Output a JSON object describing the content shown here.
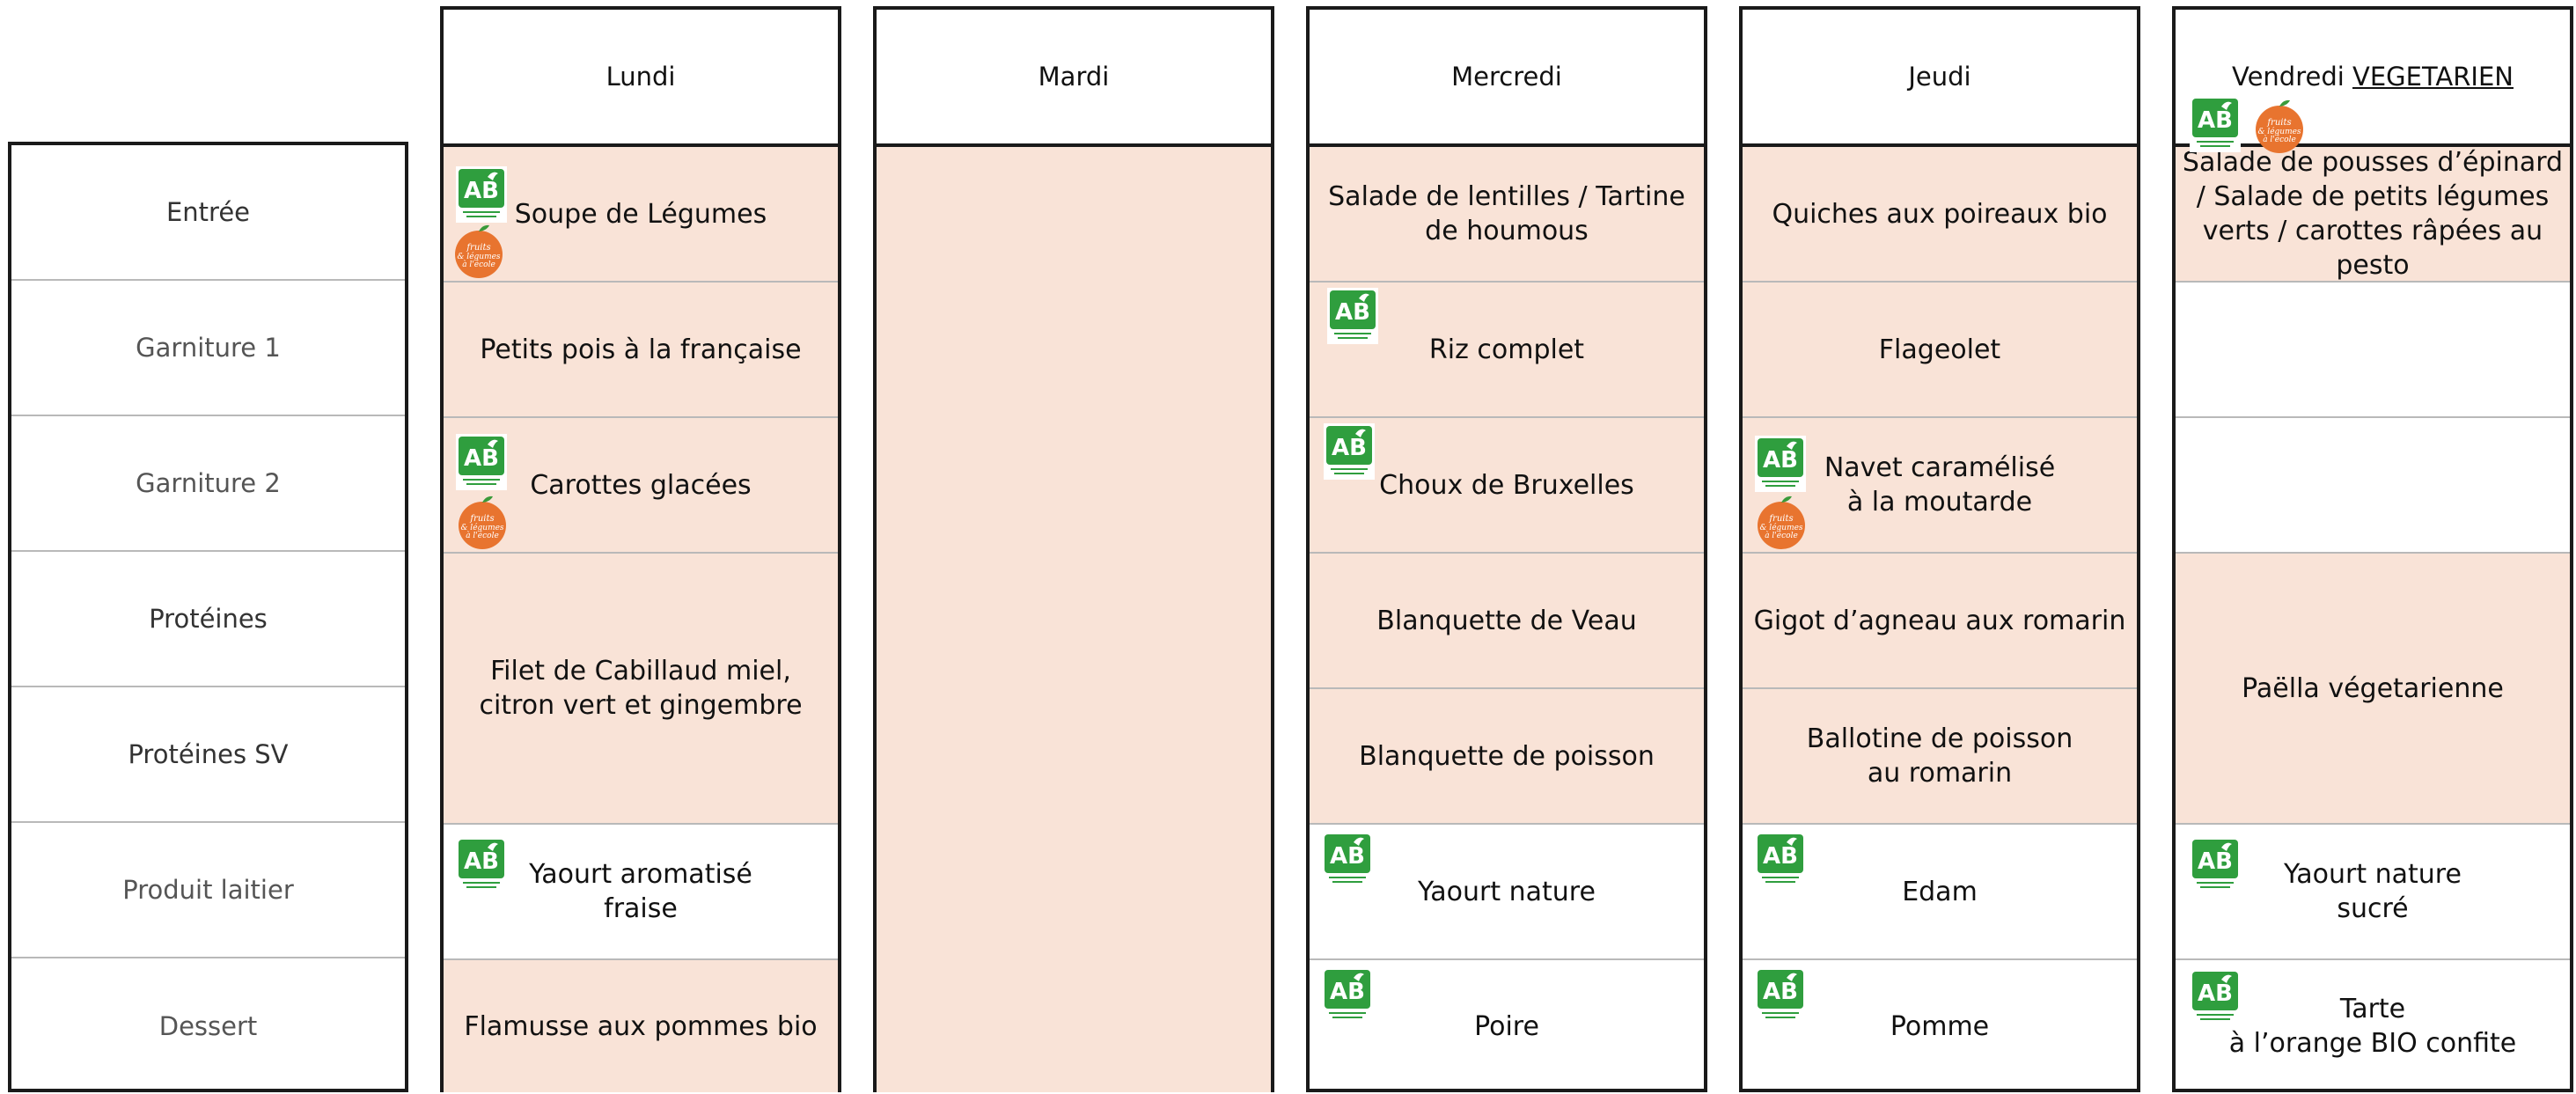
{
  "row_labels": [
    "Entrée",
    "Garniture 1",
    "Garniture 2",
    "Protéines",
    "Protéines SV",
    "Produit laitier",
    "Dessert"
  ],
  "days": {
    "lundi": "Lundi",
    "mardi": "Mardi",
    "mercredi": "Mercredi",
    "jeudi": "Jeudi",
    "vendredi": "Vendredi",
    "vendredi_tag": "VEGETARIEN"
  },
  "lundi": {
    "entree": "Soupe de Légumes",
    "garniture1": "Petits pois à la française",
    "garniture2": "Carottes glacées",
    "proteines": "Filet de Cabillaud miel, citron vert et gingembre",
    "laitier": "Yaourt aromatisé\nfraise",
    "dessert": "Flamusse aux pommes bio"
  },
  "mercredi": {
    "entree": "Salade de lentilles / Tartine de houmous",
    "garniture1": "Riz complet",
    "garniture2": "Choux de Bruxelles",
    "proteines": "Blanquette de Veau",
    "proteines_sv": "Blanquette de poisson",
    "laitier": "Yaourt nature",
    "dessert": "Poire"
  },
  "jeudi": {
    "entree": "Quiches aux poireaux bio",
    "garniture1": "Flageolet",
    "garniture2": "Navet caramélisé\nà la moutarde",
    "proteines": "Gigot d’agneau aux romarin",
    "proteines_sv": "Ballotine de poisson au romarin",
    "laitier": "Edam",
    "dessert": "Pomme"
  },
  "vendredi": {
    "entree": "Salade de pousses d’épinard / Salade de petits légumes verts / carottes râpées au pesto",
    "proteines": "Paëlla végetarienne",
    "laitier": "Yaourt nature\nsucré",
    "dessert": "Tarte\nà l’orange BIO confite"
  },
  "logos": {
    "ab_text": "AB",
    "fruits_text": "fruits & légumes à l'école",
    "ab_color": "#2f9e3e",
    "fruits_color": "#e8742f"
  },
  "colors": {
    "peach": "#f9e3d7",
    "border": "#1a1a1a"
  }
}
